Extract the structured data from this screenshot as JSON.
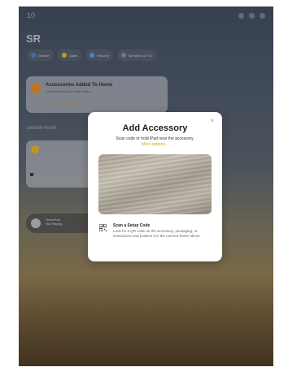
{
  "status": {
    "time": "10"
  },
  "home": {
    "title": "SR"
  },
  "chips": [
    {
      "label": "Climate",
      "color": "#4f83c9"
    },
    {
      "label": "Lights",
      "color": "#e4b22a"
    },
    {
      "label": "Security",
      "color": "#4fa3d9"
    },
    {
      "label": "Speakers & TVs",
      "color": "#7f8da0"
    }
  ],
  "accessories_card": {
    "title": "Accessories Added To Home",
    "subtitle": "Complete setup to control them.",
    "link": "Add to Favourites"
  },
  "section": {
    "label": "Default Room"
  },
  "now_playing": {
    "title": "HomePod",
    "status": "Not Playing"
  },
  "modal": {
    "title": "Add Accessory",
    "subtitle": "Scan code or hold iPad near the accessory.",
    "more_options": "More options...",
    "close_glyph": "×",
    "scan_title": "Scan a Setup Code",
    "scan_body": "Look for a QR code on the accessory, packaging, or instructions and position it in the camera frame above."
  }
}
